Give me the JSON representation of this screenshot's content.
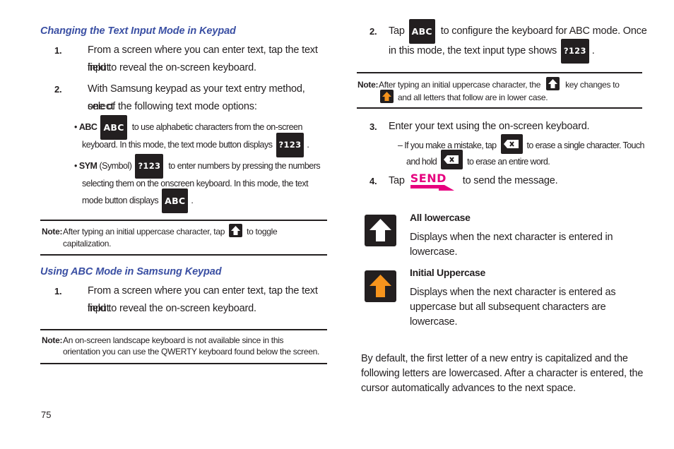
{
  "page_number": "75",
  "colors": {
    "heading": "#3a4fa3",
    "key_bg": "#231f20",
    "send": "#e6007e",
    "shift_orange": "#f7941d"
  },
  "left": {
    "section1": {
      "heading": "Changing the Text Input Mode in Keypad",
      "steps": [
        {
          "num": "1.",
          "line1": "From a screen where you can enter text, tap the text input",
          "line2": "field to reveal the on-screen keyboard."
        },
        {
          "num": "2.",
          "line1": "With Samsung keypad as your text entry method, select",
          "line2": "one of the following text mode options:"
        }
      ],
      "bullets": [
        {
          "label": "ABC",
          "key": "ABC",
          "line1_after": "to use alphabetic characters from the on-screen",
          "line2_before": "keyboard. In this mode, the text mode button displays",
          "line2_key": "?123",
          "line2_after": "."
        },
        {
          "label": "SYM",
          "label_suffix": " (Symbol)",
          "key": "?123",
          "line1_after": "to enter numbers by pressing the numbers",
          "line2": "selecting them on the onscreen keyboard. In this mode, the text",
          "line3_before": "mode button displays",
          "line3_key": "ABC",
          "line3_after": "."
        }
      ]
    },
    "note1": {
      "label": "Note:",
      "line1_before": "After typing an initial uppercase character, tap",
      "icon": "shift-white-icon",
      "line1_after": "to toggle",
      "line2": "capitalization."
    },
    "section2": {
      "heading": "Using ABC Mode in Samsung Keypad",
      "steps": [
        {
          "num": "1.",
          "line1": "From a screen where you can enter text, tap the text input",
          "line2": "field to reveal the on-screen keyboard."
        }
      ]
    },
    "note2": {
      "label": "Note:",
      "line1": "An on-screen landscape keyboard is not available since in this",
      "line2": "orientation you can use the QWERTY keyboard found below the screen."
    }
  },
  "right": {
    "step2": {
      "num": "2.",
      "before": "Tap",
      "key": "ABC",
      "after": "to configure the keyboard for ABC mode. Once",
      "line2_before": "in this mode, the text input type shows",
      "line2_key": "?123",
      "line2_after": "."
    },
    "note": {
      "label": "Note:",
      "line1_before": "After typing an initial uppercase character, the",
      "line1_icon": "shift-white-icon",
      "line1_after": "key changes to",
      "line2_icon": "shift-orange-icon",
      "line2": "and all letters that follow are in lower case."
    },
    "step3": {
      "num": "3.",
      "text": "Enter your text using the on-screen keyboard.",
      "sub": {
        "dash": "–",
        "line1_before": "If you make a mistake, tap",
        "line1_after": "to erase a single character. Touch",
        "line2_before": "and hold",
        "line2_after": "to erase an entire word."
      }
    },
    "step4": {
      "num": "4.",
      "before": "Tap",
      "key": "SEND",
      "after": "to send the message."
    },
    "definitions": [
      {
        "icon": "shift-white-icon",
        "title": "All lowercase",
        "body": [
          "Displays when the next character is entered in",
          "lowercase."
        ]
      },
      {
        "icon": "shift-orange-icon",
        "title": "Initial Uppercase",
        "body": [
          "Displays when the next character is entered as",
          "uppercase but all subsequent characters are",
          "lowercase."
        ]
      }
    ],
    "paragraph": [
      "By default, the first letter of a new entry is capitalized and the",
      "following letters are lowercased. After a character is entered, the",
      "cursor automatically advances to the next space."
    ]
  }
}
